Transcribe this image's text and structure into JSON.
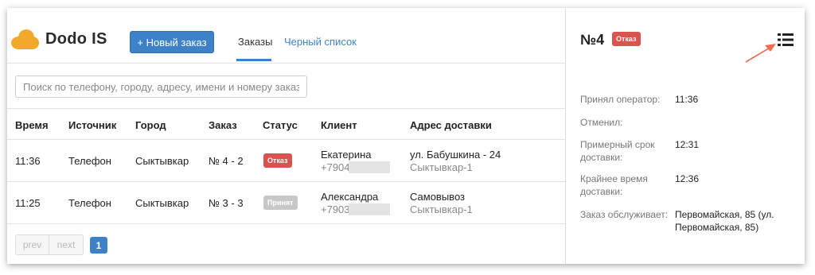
{
  "app": {
    "name": "Dodo IS",
    "new_order_label": "+ Новый заказ",
    "tabs": [
      {
        "label": "Заказы"
      },
      {
        "label": "Черный список"
      }
    ],
    "brand_color": "#3d82c9",
    "logo_color": "#f0a92a"
  },
  "search": {
    "placeholder": "Поиск по телефону, городу, адресу, имени и номеру заказа",
    "value": ""
  },
  "table": {
    "headers": [
      "Время",
      "Источник",
      "Город",
      "Заказ",
      "Статус",
      "Клиент",
      "Адрес доставки"
    ],
    "rows": [
      {
        "time": "11:36",
        "source": "Телефон",
        "city": "Сыктывкар",
        "order": "№ 4 - 2",
        "status": "Отказ",
        "status_color": "#d9534f",
        "client_name": "Екатерина",
        "client_phone": "+7904",
        "address": "ул. Бабушкина - 24",
        "address_sub": "Сыктывкар-1"
      },
      {
        "time": "11:25",
        "source": "Телефон",
        "city": "Сыктывкар",
        "order": "№ 3 - 3",
        "status": "Принят",
        "status_color": "#c7c7c7",
        "client_name": "Александра",
        "client_phone": "+7903",
        "address": "Самовывоз",
        "address_sub": "Сыктывкар-1"
      }
    ]
  },
  "pagination": {
    "prev": "prev",
    "next": "next",
    "current": "1"
  },
  "panel": {
    "title": "№4",
    "status": "Отказ",
    "details": [
      {
        "label": "Принял оператор:",
        "value": "11:36"
      },
      {
        "label": "Отменил:",
        "value": ""
      },
      {
        "label": "Примерный срок доставки:",
        "value": "12:31"
      },
      {
        "label": "Крайнее время доставки:",
        "value": "12:36"
      },
      {
        "label": "Заказ обслуживает:",
        "value": "Первомайская, 85 (ул. Первомайская, 85)"
      }
    ],
    "icons": [
      "list-icon",
      "arrow-icon"
    ]
  }
}
